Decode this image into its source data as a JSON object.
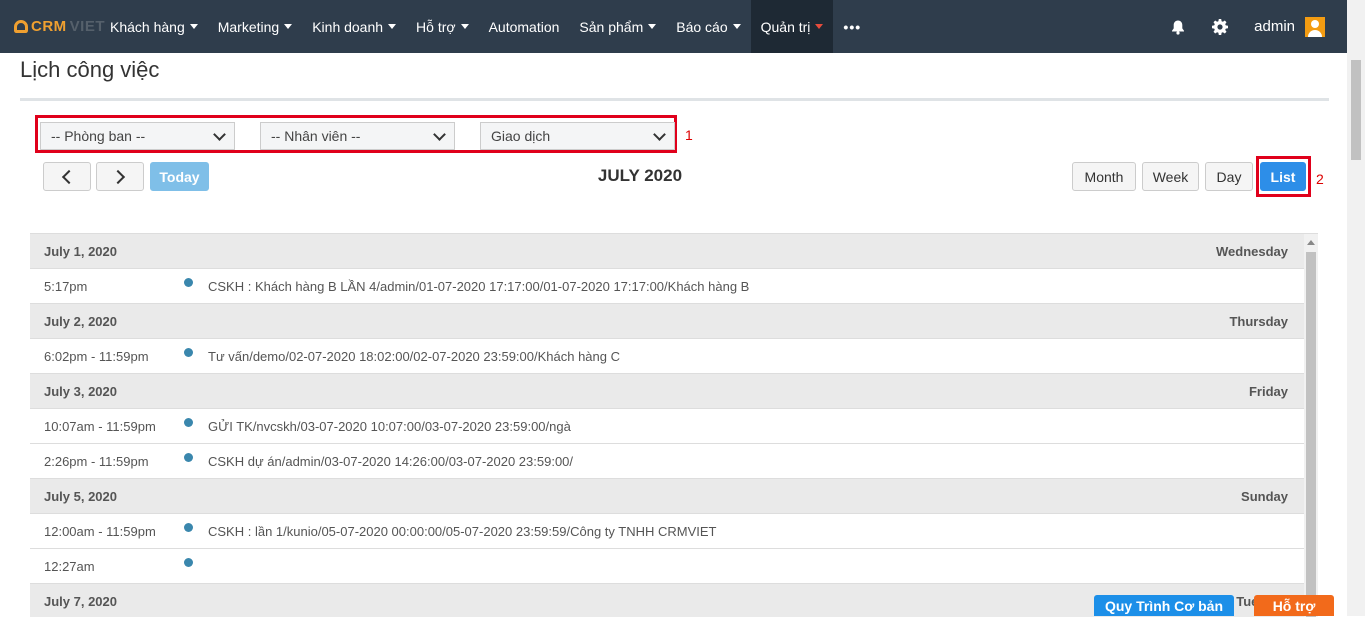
{
  "brand": {
    "crm": "CRM",
    "viet": "VIET"
  },
  "nav": {
    "items": [
      {
        "label": "Khách hàng",
        "caret": true
      },
      {
        "label": "Marketing",
        "caret": true
      },
      {
        "label": "Kinh doanh",
        "caret": true
      },
      {
        "label": "Hỗ trợ",
        "caret": true
      },
      {
        "label": "Automation",
        "caret": false
      },
      {
        "label": "Sản phẩm",
        "caret": true
      },
      {
        "label": "Báo cáo",
        "caret": true
      },
      {
        "label": "Quản trị",
        "caret": true,
        "active": true
      },
      {
        "label": "•••",
        "caret": false
      }
    ],
    "user": "admin",
    "icons": [
      "bell-icon",
      "gear-icon",
      "avatar"
    ]
  },
  "page": {
    "title": "Lịch công việc"
  },
  "filters": {
    "department": "-- Phòng ban --",
    "employee": "-- Nhân viên --",
    "type": "Giao dịch",
    "marker": "1"
  },
  "toolbar": {
    "today": "Today",
    "title": "JULY 2020",
    "views": {
      "month": "Month",
      "week": "Week",
      "day": "Day",
      "list": "List"
    },
    "active_view": "List",
    "marker": "2"
  },
  "events": [
    {
      "date": "July 1, 2020",
      "weekday": "Wednesday",
      "items": [
        {
          "time": "5:17pm",
          "title": "CSKH : Khách hàng B LẦN 4/admin/01-07-2020 17:17:00/01-07-2020 17:17:00/Khách hàng B"
        }
      ]
    },
    {
      "date": "July 2, 2020",
      "weekday": "Thursday",
      "items": [
        {
          "time": "6:02pm - 11:59pm",
          "title": "Tư vấn/demo/02-07-2020 18:02:00/02-07-2020 23:59:00/Khách hàng C"
        }
      ]
    },
    {
      "date": "July 3, 2020",
      "weekday": "Friday",
      "items": [
        {
          "time": "10:07am - 11:59pm",
          "title": "GỬI TK/nvcskh/03-07-2020 10:07:00/03-07-2020 23:59:00/ngà"
        },
        {
          "time": "2:26pm - 11:59pm",
          "title": "CSKH dự án/admin/03-07-2020 14:26:00/03-07-2020 23:59:00/"
        }
      ]
    },
    {
      "date": "July 5, 2020",
      "weekday": "Sunday",
      "items": [
        {
          "time": "12:00am - 11:59pm",
          "title": "CSKH : lần 1/kunio/05-07-2020 00:00:00/05-07-2020 23:59:59/Công ty TNHH CRMVIET"
        },
        {
          "time": "12:27am",
          "title": ""
        }
      ]
    },
    {
      "date": "July 7, 2020",
      "weekday": "Tuesday",
      "items": []
    }
  ],
  "colors": {
    "nav_bg": "#2f3d4c",
    "event_dot": "#3a87ad",
    "highlight": "#e0001b",
    "list_active": "#2d8ee8"
  },
  "bottom": {
    "process": "Quy Trình Cơ bản",
    "support": "Hỗ trợ"
  }
}
